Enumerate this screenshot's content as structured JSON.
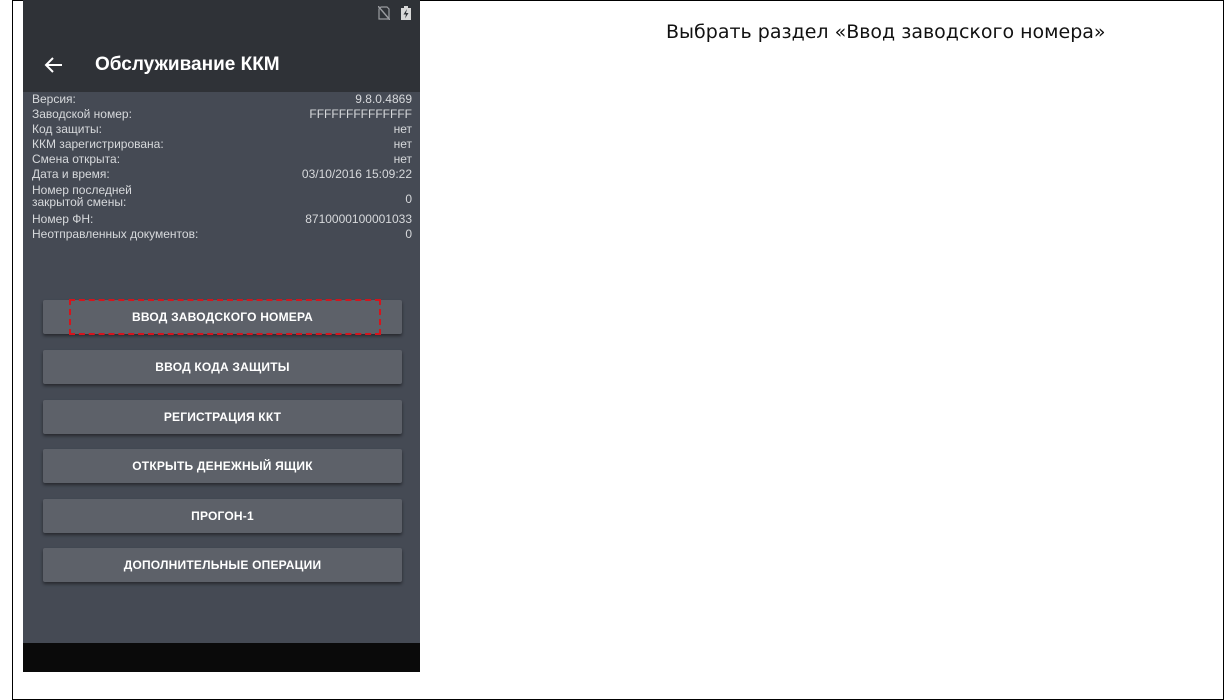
{
  "instruction": "Выбрать раздел «Ввод заводского номера»",
  "app": {
    "title": "Обслуживание ККМ",
    "back_icon": "arrow-left-icon",
    "status_icons": [
      "no-sim-icon",
      "battery-charging-icon"
    ]
  },
  "info_rows": [
    {
      "label": "Версия:",
      "value": "9.8.0.4869"
    },
    {
      "label": "Заводской номер:",
      "value": "FFFFFFFFFFFFFF"
    },
    {
      "label": "Код защиты:",
      "value": "нет"
    },
    {
      "label": "ККМ зарегистрирована:",
      "value": "нет"
    },
    {
      "label": "Смена открыта:",
      "value": "нет"
    },
    {
      "label": "Дата и время:",
      "value": "03/10/2016 15:09:22"
    },
    {
      "label": "Номер последней закрытой смены:",
      "value": "0"
    },
    {
      "label": "Номер ФН:",
      "value": "8710000100001033"
    },
    {
      "label": "Неотправленных документов:",
      "value": "0"
    }
  ],
  "buttons": [
    {
      "label": "ВВОД ЗАВОДСКОГО НОМЕРА",
      "highlighted": true
    },
    {
      "label": "ВВОД КОДА ЗАЩИТЫ"
    },
    {
      "label": "РЕГИСТРАЦИЯ ККТ"
    },
    {
      "label": "ОТКРЫТЬ ДЕНЕЖНЫЙ ЯЩИК"
    },
    {
      "label": "ПРОГОН-1"
    },
    {
      "label": "ДОПОЛНИТЕЛЬНЫЕ ОПЕРАЦИИ"
    }
  ],
  "colors": {
    "app_background": "#454a54",
    "appbar": "#2f3237",
    "button": "#5d6169",
    "highlight": "#d4141c"
  }
}
